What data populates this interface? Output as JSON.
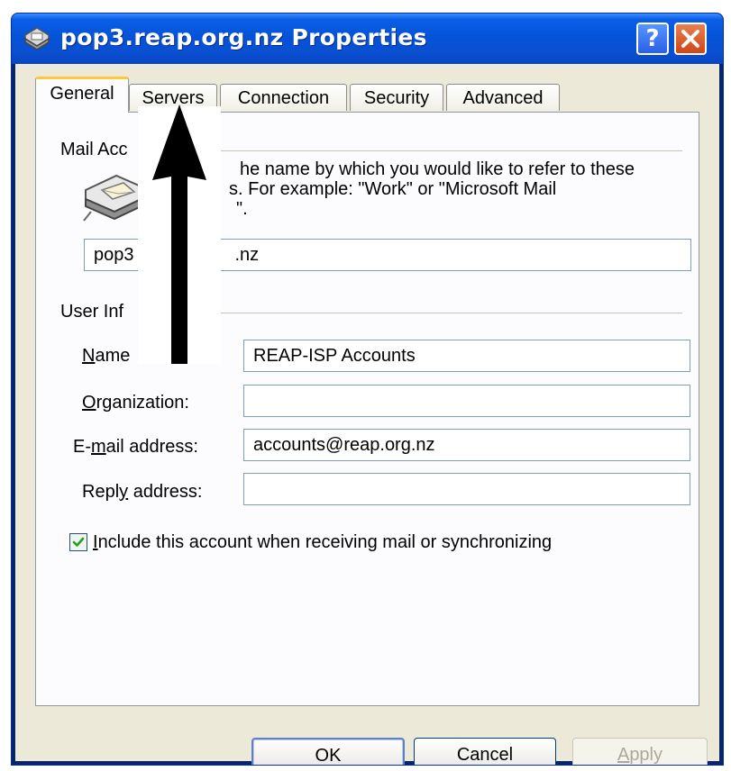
{
  "window": {
    "title": "pop3.reap.org.nz Properties",
    "title_icon": "mail-account-icon",
    "help_label": "?",
    "close_label": "✕"
  },
  "tabs": [
    {
      "label": "General",
      "active": true
    },
    {
      "label": "Servers",
      "active": false
    },
    {
      "label": "Connection",
      "active": false
    },
    {
      "label": "Security",
      "active": false
    },
    {
      "label": "Advanced",
      "active": false
    }
  ],
  "mail_account": {
    "section_label": "Mail Acc",
    "description_line1": "he name by which you would like to refer to these",
    "description_line2": "s.  For example: \"Work\" or \"Microsoft Mail",
    "description_line3": "\".",
    "account_name_prefix": "pop3",
    "account_name_suffix": ".nz",
    "icon": "mail-server-icon"
  },
  "user_info": {
    "section_label": "User Inf",
    "fields": [
      {
        "label_pre": "",
        "label_mnemonic": "N",
        "label_post": "ame",
        "value": "REAP-ISP Accounts"
      },
      {
        "label_pre": "",
        "label_mnemonic": "O",
        "label_post": "rganization:",
        "value": ""
      },
      {
        "label_pre": "E-",
        "label_mnemonic": "m",
        "label_post": "ail address:",
        "value": "accounts@reap.org.nz"
      },
      {
        "label_pre": "Repl",
        "label_mnemonic": "y",
        "label_post": " address:",
        "value": ""
      }
    ]
  },
  "include_checkbox": {
    "checked": true,
    "label_mnemonic": "I",
    "label_rest": "nclude this account when receiving mail or synchronizing"
  },
  "buttons": {
    "ok": "OK",
    "cancel": "Cancel",
    "apply_mnemonic": "A",
    "apply_rest": "pply"
  },
  "colors": {
    "titlebar": "#0553d8",
    "dialog_face": "#ece9d8",
    "panel": "#fcfcfe",
    "active_tab_accent": "#ffc83c",
    "checkbox_mark": "#21a121"
  }
}
